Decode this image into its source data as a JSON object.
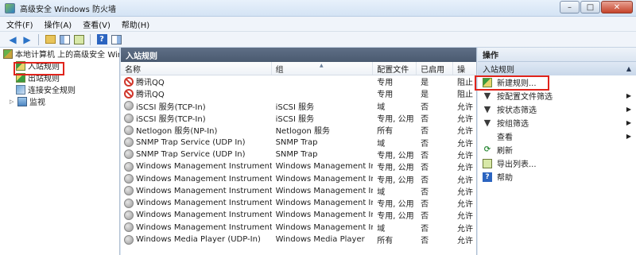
{
  "window": {
    "title": "高级安全 Windows 防火墙",
    "minimize": "–",
    "maximize": "□",
    "close": "✕"
  },
  "menu": [
    "文件(F)",
    "操作(A)",
    "查看(V)",
    "帮助(H)"
  ],
  "tree": {
    "root": "本地计算机 上的高级安全 Windows 防火墙",
    "items": [
      "入站规则",
      "出站规则",
      "连接安全规则",
      "监视"
    ],
    "selected": "入站规则"
  },
  "center": {
    "title": "入站规则",
    "columns": [
      "名称",
      "组",
      "配置文件",
      "已启用",
      "操"
    ],
    "rows": [
      {
        "icon": "block-icon",
        "name": "腾讯QQ",
        "group": "",
        "profile": "专用",
        "enabled": "是",
        "action": "阻止"
      },
      {
        "icon": "block-icon",
        "name": "腾讯QQ",
        "group": "",
        "profile": "专用",
        "enabled": "是",
        "action": "阻止"
      },
      {
        "icon": "allow-icon",
        "name": "iSCSI 服务(TCP-In)",
        "group": "iSCSI 服务",
        "profile": "域",
        "enabled": "否",
        "action": "允许"
      },
      {
        "icon": "allow-icon",
        "name": "iSCSI 服务(TCP-In)",
        "group": "iSCSI 服务",
        "profile": "专用, 公用",
        "enabled": "否",
        "action": "允许"
      },
      {
        "icon": "allow-icon",
        "name": "Netlogon 服务(NP-In)",
        "group": "Netlogon 服务",
        "profile": "所有",
        "enabled": "否",
        "action": "允许"
      },
      {
        "icon": "allow-icon",
        "name": "SNMP Trap Service (UDP In)",
        "group": "SNMP Trap",
        "profile": "域",
        "enabled": "否",
        "action": "允许"
      },
      {
        "icon": "allow-icon",
        "name": "SNMP Trap Service (UDP In)",
        "group": "SNMP Trap",
        "profile": "专用, 公用",
        "enabled": "否",
        "action": "允许"
      },
      {
        "icon": "allow-icon",
        "name": "Windows Management Instrumentati...",
        "group": "Windows Management In...",
        "profile": "专用, 公用",
        "enabled": "否",
        "action": "允许"
      },
      {
        "icon": "allow-icon",
        "name": "Windows Management Instrumentati...",
        "group": "Windows Management In...",
        "profile": "专用, 公用",
        "enabled": "否",
        "action": "允许"
      },
      {
        "icon": "allow-icon",
        "name": "Windows Management Instrumentati...",
        "group": "Windows Management In...",
        "profile": "域",
        "enabled": "否",
        "action": "允许"
      },
      {
        "icon": "allow-icon",
        "name": "Windows Management Instrumentati...",
        "group": "Windows Management In...",
        "profile": "专用, 公用",
        "enabled": "否",
        "action": "允许"
      },
      {
        "icon": "allow-icon",
        "name": "Windows Management Instrumentati...",
        "group": "Windows Management In...",
        "profile": "专用, 公用",
        "enabled": "否",
        "action": "允许"
      },
      {
        "icon": "allow-icon",
        "name": "Windows Management Instrumentati...",
        "group": "Windows Management In...",
        "profile": "域",
        "enabled": "否",
        "action": "允许"
      },
      {
        "icon": "allow-icon",
        "name": "Windows Media Player (UDP-In)",
        "group": "Windows Media Player",
        "profile": "所有",
        "enabled": "否",
        "action": "允许"
      }
    ]
  },
  "actions": {
    "title": "操作",
    "section": "入站规则",
    "items": [
      {
        "label": "新建规则...",
        "icon": "new-rule-icon",
        "submenu": false
      },
      {
        "label": "按配置文件筛选",
        "icon": "filter-icon",
        "submenu": true
      },
      {
        "label": "按状态筛选",
        "icon": "filter-icon",
        "submenu": true
      },
      {
        "label": "按组筛选",
        "icon": "filter-icon",
        "submenu": true
      },
      {
        "label": "查看",
        "icon": "",
        "submenu": true
      },
      {
        "label": "刷新",
        "icon": "refresh-icon",
        "submenu": false
      },
      {
        "label": "导出列表...",
        "icon": "export-icon",
        "submenu": false
      },
      {
        "label": "帮助",
        "icon": "help-icon",
        "submenu": false
      }
    ]
  }
}
